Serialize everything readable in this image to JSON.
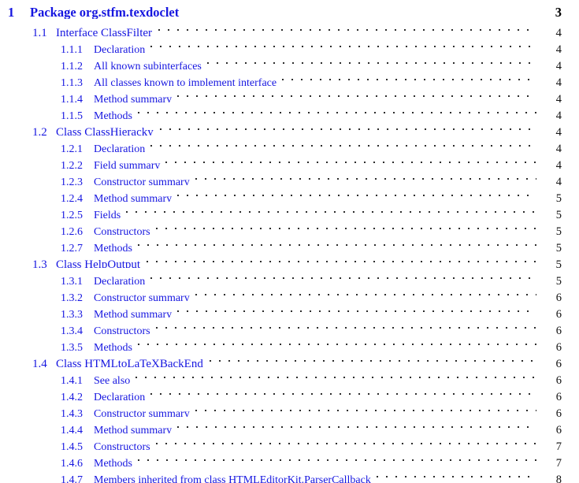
{
  "document": {
    "kind": "table-of-contents",
    "colors": {
      "link": "#1616e0",
      "page_number": "#111111",
      "leader_dot": "#2b2b2b",
      "background": "#ffffff"
    }
  },
  "entries": [
    {
      "level": 1,
      "number": "1",
      "label": "Package org.stfm.texdoclet",
      "page": "3"
    },
    {
      "level": 2,
      "number": "1.1",
      "label": "Interface ClassFilter",
      "page": "4"
    },
    {
      "level": 3,
      "number": "1.1.1",
      "label": "Declaration",
      "page": "4"
    },
    {
      "level": 3,
      "number": "1.1.2",
      "label": "All known subinterfaces",
      "page": "4"
    },
    {
      "level": 3,
      "number": "1.1.3",
      "label": "All classes known to implement interface",
      "page": "4"
    },
    {
      "level": 3,
      "number": "1.1.4",
      "label": "Method summary",
      "page": "4"
    },
    {
      "level": 3,
      "number": "1.1.5",
      "label": "Methods",
      "page": "4"
    },
    {
      "level": 2,
      "number": "1.2",
      "label": "Class ClassHieracky",
      "page": "4"
    },
    {
      "level": 3,
      "number": "1.2.1",
      "label": "Declaration",
      "page": "4"
    },
    {
      "level": 3,
      "number": "1.2.2",
      "label": "Field summary",
      "page": "4"
    },
    {
      "level": 3,
      "number": "1.2.3",
      "label": "Constructor summary",
      "page": "4"
    },
    {
      "level": 3,
      "number": "1.2.4",
      "label": "Method summary",
      "page": "5"
    },
    {
      "level": 3,
      "number": "1.2.5",
      "label": "Fields",
      "page": "5"
    },
    {
      "level": 3,
      "number": "1.2.6",
      "label": "Constructors",
      "page": "5"
    },
    {
      "level": 3,
      "number": "1.2.7",
      "label": "Methods",
      "page": "5"
    },
    {
      "level": 2,
      "number": "1.3",
      "label": "Class HelpOutput",
      "page": "5"
    },
    {
      "level": 3,
      "number": "1.3.1",
      "label": "Declaration",
      "page": "5"
    },
    {
      "level": 3,
      "number": "1.3.2",
      "label": "Constructor summary",
      "page": "6"
    },
    {
      "level": 3,
      "number": "1.3.3",
      "label": "Method summary",
      "page": "6"
    },
    {
      "level": 3,
      "number": "1.3.4",
      "label": "Constructors",
      "page": "6"
    },
    {
      "level": 3,
      "number": "1.3.5",
      "label": "Methods",
      "page": "6"
    },
    {
      "level": 2,
      "number": "1.4",
      "label": "Class HTMLtoLaTeXBackEnd",
      "page": "6"
    },
    {
      "level": 3,
      "number": "1.4.1",
      "label": "See also",
      "page": "6"
    },
    {
      "level": 3,
      "number": "1.4.2",
      "label": "Declaration",
      "page": "6"
    },
    {
      "level": 3,
      "number": "1.4.3",
      "label": "Constructor summary",
      "page": "6"
    },
    {
      "level": 3,
      "number": "1.4.4",
      "label": "Method summary",
      "page": "6"
    },
    {
      "level": 3,
      "number": "1.4.5",
      "label": "Constructors",
      "page": "7"
    },
    {
      "level": 3,
      "number": "1.4.6",
      "label": "Methods",
      "page": "7"
    },
    {
      "level": 3,
      "number": "1.4.7",
      "label": "Members inherited from class HTMLEditorKit.ParserCallback",
      "page": "8"
    }
  ]
}
